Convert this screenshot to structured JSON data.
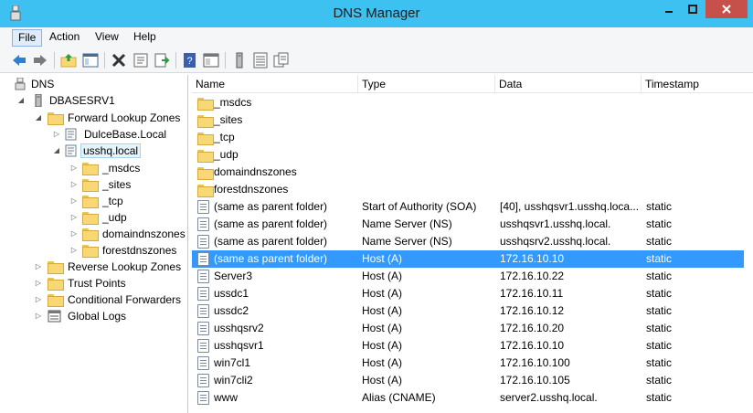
{
  "window": {
    "title": "DNS Manager"
  },
  "menu": {
    "file": "File",
    "action": "Action",
    "view": "View",
    "help": "Help"
  },
  "tree": {
    "root": "DNS",
    "server": "DBASESRV1",
    "forward": "Forward Lookup Zones",
    "dulce": "DulceBase.Local",
    "usshq": "usshq.local",
    "msdcs": "_msdcs",
    "sites": "_sites",
    "tcp": "_tcp",
    "udp": "_udp",
    "domaindns": "domaindnszones",
    "forestdns": "forestdnszones",
    "reverse": "Reverse Lookup Zones",
    "trust": "Trust Points",
    "conditional": "Conditional Forwarders",
    "global": "Global Logs"
  },
  "columns": {
    "name": "Name",
    "type": "Type",
    "data": "Data",
    "timestamp": "Timestamp"
  },
  "records": [
    {
      "name": "_msdcs",
      "type": "",
      "data": "",
      "timestamp": "",
      "kind": "folder"
    },
    {
      "name": "_sites",
      "type": "",
      "data": "",
      "timestamp": "",
      "kind": "folder"
    },
    {
      "name": "_tcp",
      "type": "",
      "data": "",
      "timestamp": "",
      "kind": "folder"
    },
    {
      "name": "_udp",
      "type": "",
      "data": "",
      "timestamp": "",
      "kind": "folder"
    },
    {
      "name": "domaindnszones",
      "type": "",
      "data": "",
      "timestamp": "",
      "kind": "folder"
    },
    {
      "name": "forestdnszones",
      "type": "",
      "data": "",
      "timestamp": "",
      "kind": "folder"
    },
    {
      "name": "(same as parent folder)",
      "type": "Start of Authority (SOA)",
      "data": "[40], usshqsvr1.usshq.loca...",
      "timestamp": "static",
      "kind": "record"
    },
    {
      "name": "(same as parent folder)",
      "type": "Name Server (NS)",
      "data": "usshqsvr1.usshq.local.",
      "timestamp": "static",
      "kind": "record"
    },
    {
      "name": "(same as parent folder)",
      "type": "Name Server (NS)",
      "data": "usshqsrv2.usshq.local.",
      "timestamp": "static",
      "kind": "record"
    },
    {
      "name": "(same as parent folder)",
      "type": "Host (A)",
      "data": "172.16.10.10",
      "timestamp": "static",
      "kind": "record",
      "selected": true
    },
    {
      "name": "Server3",
      "type": "Host (A)",
      "data": "172.16.10.22",
      "timestamp": "static",
      "kind": "record"
    },
    {
      "name": "ussdc1",
      "type": "Host (A)",
      "data": "172.16.10.11",
      "timestamp": "static",
      "kind": "record"
    },
    {
      "name": "ussdc2",
      "type": "Host (A)",
      "data": "172.16.10.12",
      "timestamp": "static",
      "kind": "record"
    },
    {
      "name": "usshqsrv2",
      "type": "Host (A)",
      "data": "172.16.10.20",
      "timestamp": "static",
      "kind": "record"
    },
    {
      "name": "usshqsvr1",
      "type": "Host (A)",
      "data": "172.16.10.10",
      "timestamp": "static",
      "kind": "record"
    },
    {
      "name": "win7cl1",
      "type": "Host (A)",
      "data": "172.16.10.100",
      "timestamp": "static",
      "kind": "record"
    },
    {
      "name": "win7cli2",
      "type": "Host (A)",
      "data": "172.16.10.105",
      "timestamp": "static",
      "kind": "record"
    },
    {
      "name": "www",
      "type": "Alias (CNAME)",
      "data": "server2.usshq.local.",
      "timestamp": "static",
      "kind": "record"
    }
  ],
  "icons": {
    "toolbar": [
      "back-icon",
      "forward-icon",
      "up-folder-icon",
      "show-hide-tree-icon",
      "delete-icon",
      "properties-icon",
      "export-icon",
      "help-icon",
      "console-icon",
      "server-icon",
      "list-icon",
      "copy-icon"
    ]
  },
  "colors": {
    "titlebar": "#3dc1f1",
    "selection": "#3399ff",
    "close": "#c7504a"
  }
}
